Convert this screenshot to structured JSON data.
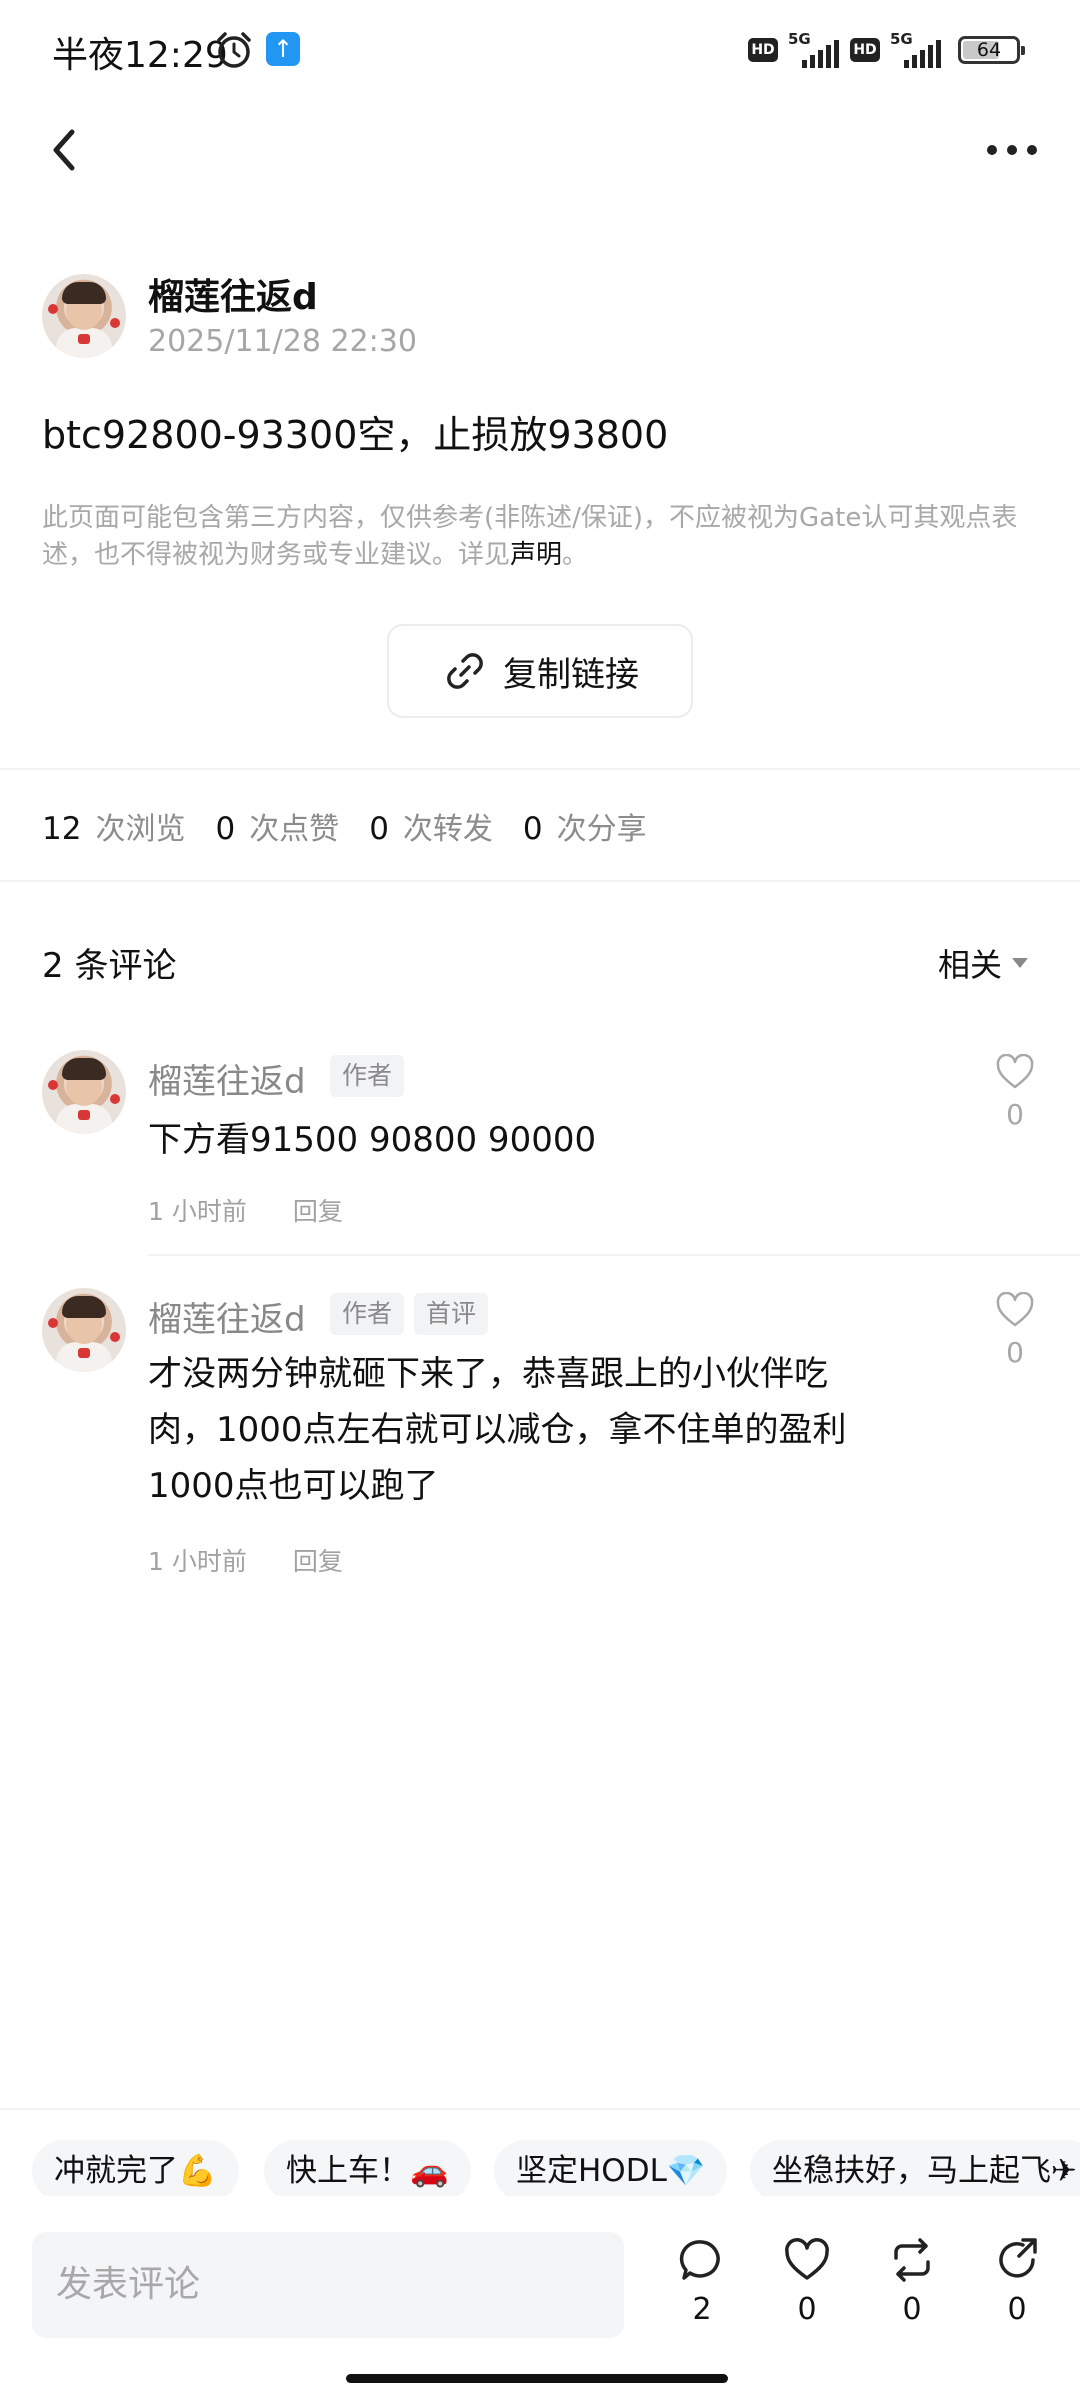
{
  "status_bar": {
    "time": "半夜12:29",
    "battery": "64",
    "network_1": "5G",
    "network_2": "5G",
    "hd": "HD"
  },
  "post": {
    "author": "榴莲往返d",
    "time": "2025/11/28 22:30",
    "content": "btc92800-93300空，止损放93800",
    "disclaimer": "此页面可能包含第三方内容，仅供参考(非陈述/保证)，不应被视为Gate认可其观点表述，也不得被视为财务或专业建议。详见",
    "disclaimer_link": "声明",
    "disclaimer_end": "。",
    "copy_link_label": "复制链接"
  },
  "stats": [
    {
      "value": "12",
      "label": "次浏览"
    },
    {
      "value": "0",
      "label": "次点赞"
    },
    {
      "value": "0",
      "label": "次转发"
    },
    {
      "value": "0",
      "label": "次分享"
    }
  ],
  "comments_section": {
    "count_label": "2 条评论",
    "sort_label": "相关"
  },
  "comments": [
    {
      "author": "榴莲往返d",
      "tags": [
        "作者"
      ],
      "text": "下方看91500 90800 90000",
      "time": "1 小时前",
      "reply": "回复",
      "likes": "0"
    },
    {
      "author": "榴莲往返d",
      "tags": [
        "作者",
        "首评"
      ],
      "text_lines": [
        "才没两分钟就砸下来了，恭喜跟上的小伙伴吃",
        "肉，1000点左右就可以减仓，拿不住单的盈利",
        "1000点也可以跑了"
      ],
      "time": "1 小时前",
      "reply": "回复",
      "likes": "0"
    }
  ],
  "quick_replies": [
    "冲就完了💪",
    "快上车！🚗",
    "坚定HODL💎",
    "坐稳扶好，马上起飞✈"
  ],
  "bottom_bar": {
    "input_placeholder": "发表评论",
    "comment_count": "2",
    "like_count": "0",
    "repost_count": "0",
    "share_count": "0"
  }
}
